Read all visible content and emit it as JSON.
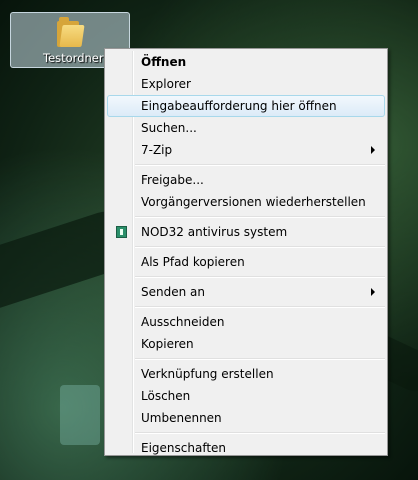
{
  "desktop": {
    "folder_label": "Testordner",
    "folder_icon": "folder-icon"
  },
  "context_menu": {
    "items": [
      {
        "label": "Öffnen",
        "bold": true
      },
      {
        "label": "Explorer"
      },
      {
        "label": "Eingabeaufforderung hier öffnen",
        "highlighted": true
      },
      {
        "label": "Suchen..."
      },
      {
        "label": "7-Zip",
        "submenu": true
      },
      {
        "label": "Freigabe..."
      },
      {
        "label": "Vorgängerversionen wiederherstellen"
      },
      {
        "label": "NOD32 antivirus system",
        "icon": "nod32-icon"
      },
      {
        "label": "Als Pfad kopieren"
      },
      {
        "label": "Senden an",
        "submenu": true
      },
      {
        "label": "Ausschneiden"
      },
      {
        "label": "Kopieren"
      },
      {
        "label": "Verknüpfung erstellen"
      },
      {
        "label": "Löschen"
      },
      {
        "label": "Umbenennen"
      },
      {
        "label": "Eigenschaften"
      }
    ]
  },
  "colors": {
    "menu_background": "#f0f0f0",
    "highlight_border": "#a8d8eb",
    "nod32_icon": "#2a8f6a"
  }
}
